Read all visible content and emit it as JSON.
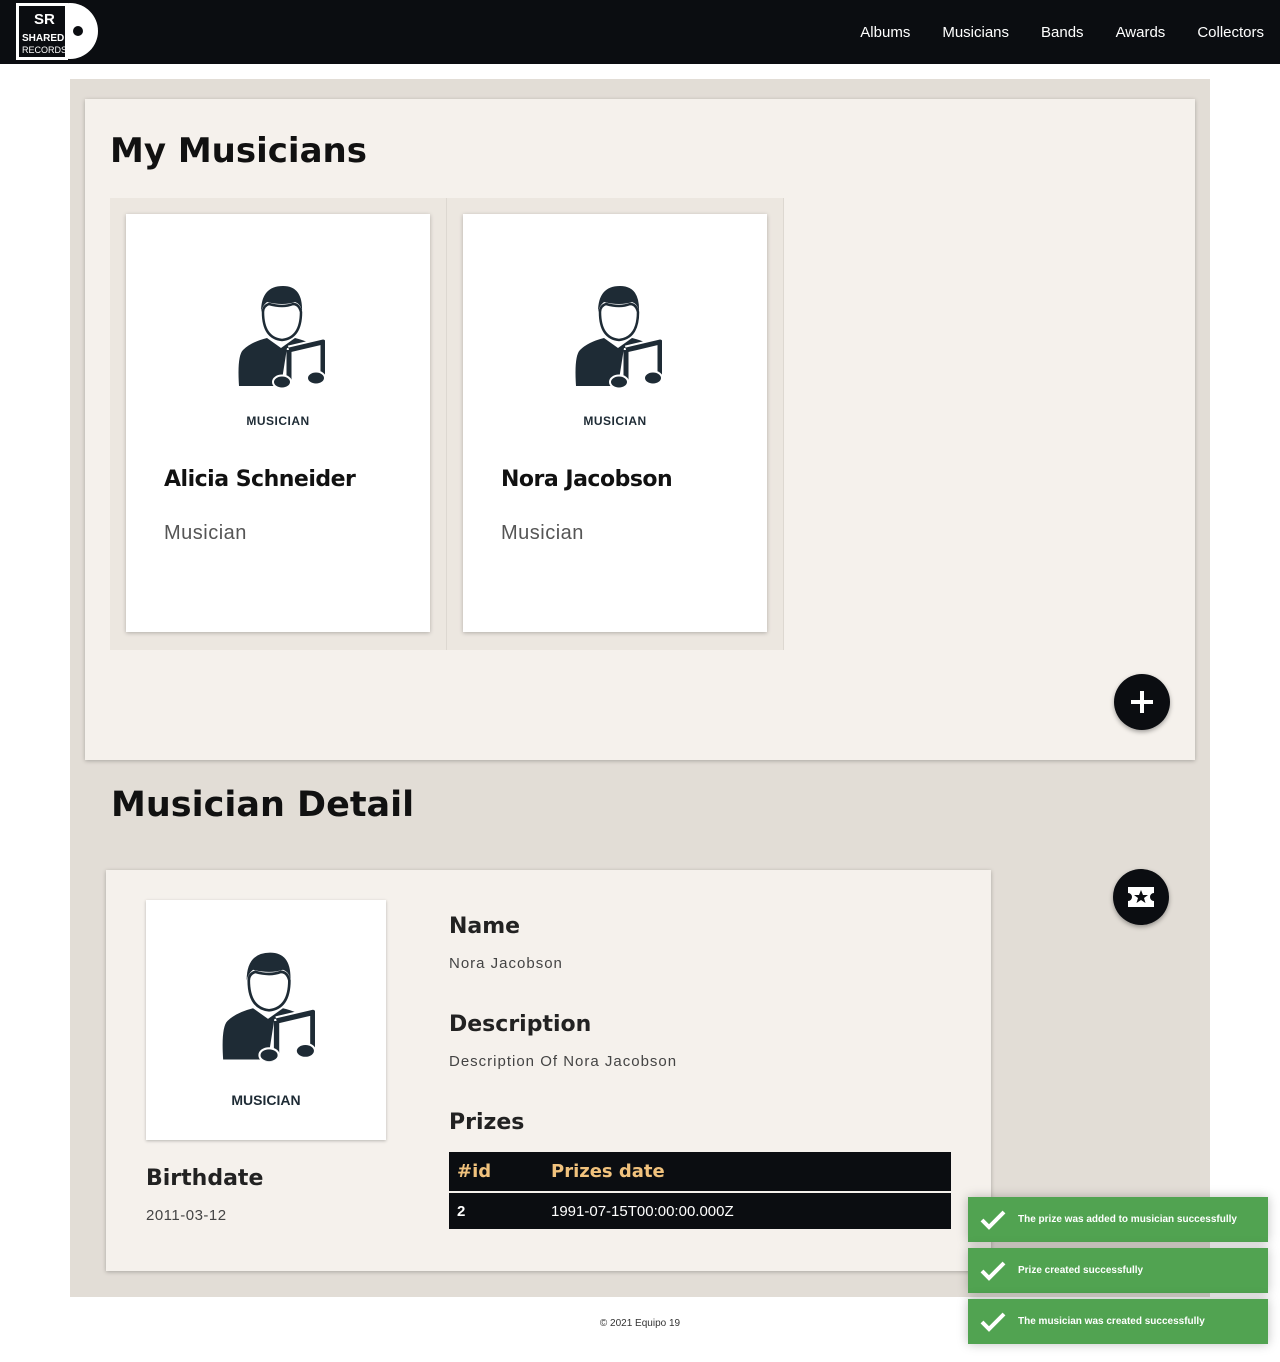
{
  "nav": {
    "logo_text": "SR SHARED RECORDS",
    "links": [
      "Albums",
      "Musicians",
      "Bands",
      "Awards",
      "Collectors"
    ]
  },
  "my_musicians": {
    "title": "My Musicians",
    "cards": [
      {
        "image_label": "MUSICIAN",
        "name": "Alicia Schneider",
        "role": "Musician"
      },
      {
        "image_label": "MUSICIAN",
        "name": "Nora Jacobson",
        "role": "Musician"
      }
    ],
    "add_icon": "plus-icon"
  },
  "detail": {
    "title": "Musician Detail",
    "image_label": "MUSICIAN",
    "name_label": "Name",
    "name_value": "Nora Jacobson",
    "description_label": "Description",
    "description_value": "Description Of Nora Jacobson",
    "prizes_label": "Prizes",
    "prizes_table": {
      "headers": [
        "#id",
        "Prizes date"
      ],
      "rows": [
        [
          "2",
          "1991-07-15T00:00:00.000Z"
        ]
      ]
    },
    "birthdate_label": "Birthdate",
    "birthdate_value": "2011-03-12",
    "prize_icon": "ticket-star-icon"
  },
  "footer": "© 2021 Equipo 19",
  "toasts": [
    "The prize was added to musician successfully",
    "Prize created successfully",
    "The musician was created successfully"
  ],
  "colors": {
    "navbar": "#0b0d11",
    "page_bg": "#e2ddd6",
    "card_bg": "#f5f1ec",
    "table_header_text": "#f1c27d",
    "toast_success": "#51a351",
    "icon_dark": "#1e2b35"
  }
}
